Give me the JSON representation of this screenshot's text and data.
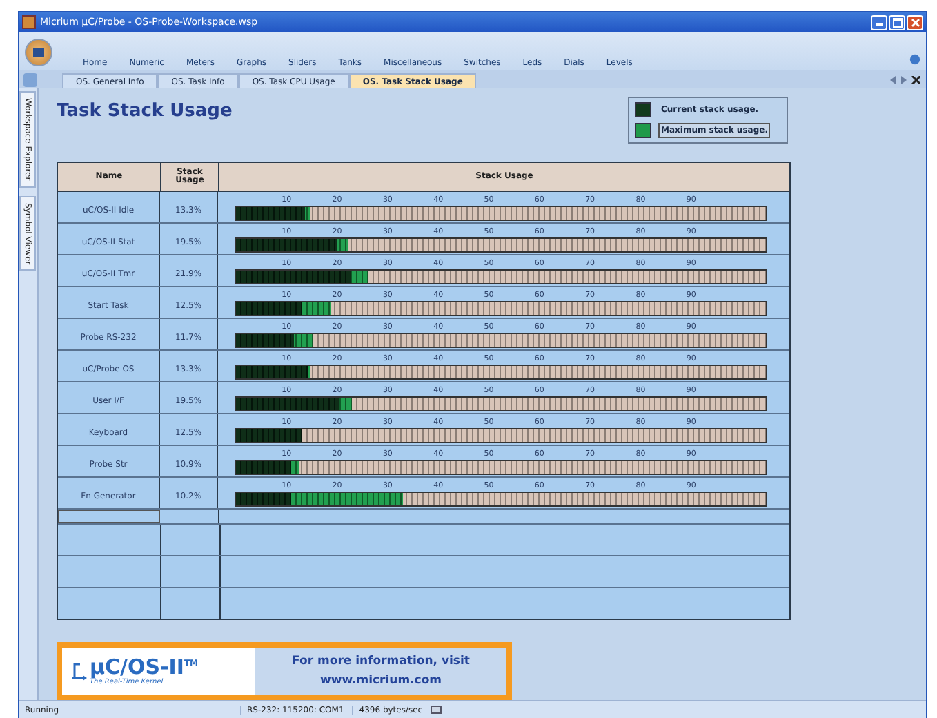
{
  "window": {
    "title": "Micrium µC/Probe - OS-Probe-Workspace.wsp"
  },
  "ribbon": {
    "menu": [
      {
        "label": "Home"
      },
      {
        "label": "Numeric"
      },
      {
        "label": "Meters"
      },
      {
        "label": "Graphs"
      },
      {
        "label": "Sliders"
      },
      {
        "label": "Tanks"
      },
      {
        "label": "Miscellaneous"
      },
      {
        "label": "Switches"
      },
      {
        "label": "Leds"
      },
      {
        "label": "Dials"
      },
      {
        "label": "Levels"
      }
    ]
  },
  "tabs": [
    {
      "label": "OS. General Info",
      "selected": false
    },
    {
      "label": "OS. Task Info",
      "selected": false
    },
    {
      "label": "OS. Task CPU Usage",
      "selected": false
    },
    {
      "label": "OS. Task Stack Usage",
      "selected": true
    }
  ],
  "sidebar": {
    "items": [
      {
        "label": "Workspace Explorer"
      },
      {
        "label": "Symbol Viewer"
      }
    ]
  },
  "page": {
    "title": "Task Stack Usage",
    "legend": [
      {
        "label": "Current stack usage.",
        "color": "#123a1c",
        "selected": false
      },
      {
        "label": "Maximum stack usage.",
        "color": "#1f9a4a",
        "selected": true
      }
    ],
    "table": {
      "columns": [
        "Name",
        "Stack Usage",
        "Stack Usage"
      ],
      "rows": [
        {
          "name": "uC/OS-II Idle",
          "usage": "13.3%",
          "current": {
            "level": 0.13
          },
          "maximum": {
            "level": 0.14
          },
          "ticks": [
            "10",
            "20",
            "30",
            "40",
            "50",
            "60",
            "70",
            "80",
            "90"
          ]
        },
        {
          "name": "uC/OS-II Stat",
          "usage": "19.5%",
          "current": {
            "level": 0.19
          },
          "maximum": {
            "level": 0.21
          },
          "ticks": [
            "10",
            "20",
            "30",
            "40",
            "50",
            "60",
            "70",
            "80",
            "90"
          ]
        },
        {
          "name": "uC/OS-II Tmr",
          "usage": "21.9%",
          "current": {
            "level": 0.215
          },
          "maximum": {
            "level": 0.25
          },
          "ticks": [
            "10",
            "20",
            "30",
            "40",
            "50",
            "60",
            "70",
            "80",
            "90"
          ]
        },
        {
          "name": "Start Task",
          "usage": "12.5%",
          "current": {
            "level": 0.125
          },
          "maximum": {
            "level": 0.18
          },
          "ticks": [
            "10",
            "20",
            "30",
            "40",
            "50",
            "60",
            "70",
            "80",
            "90"
          ]
        },
        {
          "name": "Probe RS-232",
          "usage": "11.7%",
          "current": {
            "level": 0.11
          },
          "maximum": {
            "level": 0.145
          },
          "ticks": [
            "10",
            "20",
            "30",
            "40",
            "50",
            "60",
            "70",
            "80",
            "90"
          ]
        },
        {
          "name": "uC/Probe OS",
          "usage": "13.3%",
          "current": {
            "level": 0.135
          },
          "maximum": {
            "level": 0.14
          },
          "ticks": [
            "10",
            "20",
            "30",
            "40",
            "50",
            "60",
            "70",
            "80",
            "90"
          ]
        },
        {
          "name": "User I/F",
          "usage": "19.5%",
          "current": {
            "level": 0.195
          },
          "maximum": {
            "level": 0.22
          },
          "ticks": [
            "10",
            "20",
            "30",
            "40",
            "50",
            "60",
            "70",
            "80",
            "90"
          ]
        },
        {
          "name": "Keyboard",
          "usage": "12.5%",
          "current": {
            "level": 0.125
          },
          "maximum": {
            "level": 0.125
          },
          "ticks": [
            "10",
            "20",
            "30",
            "40",
            "50",
            "60",
            "70",
            "80",
            "90"
          ]
        },
        {
          "name": "Probe Str",
          "usage": "10.9%",
          "current": {
            "level": 0.105
          },
          "maximum": {
            "level": 0.12
          },
          "ticks": [
            "10",
            "20",
            "30",
            "40",
            "50",
            "60",
            "70",
            "80",
            "90"
          ]
        },
        {
          "name": "Fn Generator",
          "usage": "10.2%",
          "current": {
            "level": 0.105
          },
          "maximum": {
            "level": 0.315
          },
          "ticks": [
            "10",
            "20",
            "30",
            "40",
            "50",
            "60",
            "70",
            "80",
            "90"
          ]
        }
      ]
    },
    "banner": {
      "logo": "µC/OS-II",
      "trademark": "TM",
      "tagline": "The Real-Time Kernel",
      "line_1": "For more information, visit",
      "line_2": "www.micrium.com"
    }
  },
  "status_bar": {
    "state": "Running",
    "port": "RS-232: 115200: COM1",
    "rate": "4396 bytes/sec"
  }
}
